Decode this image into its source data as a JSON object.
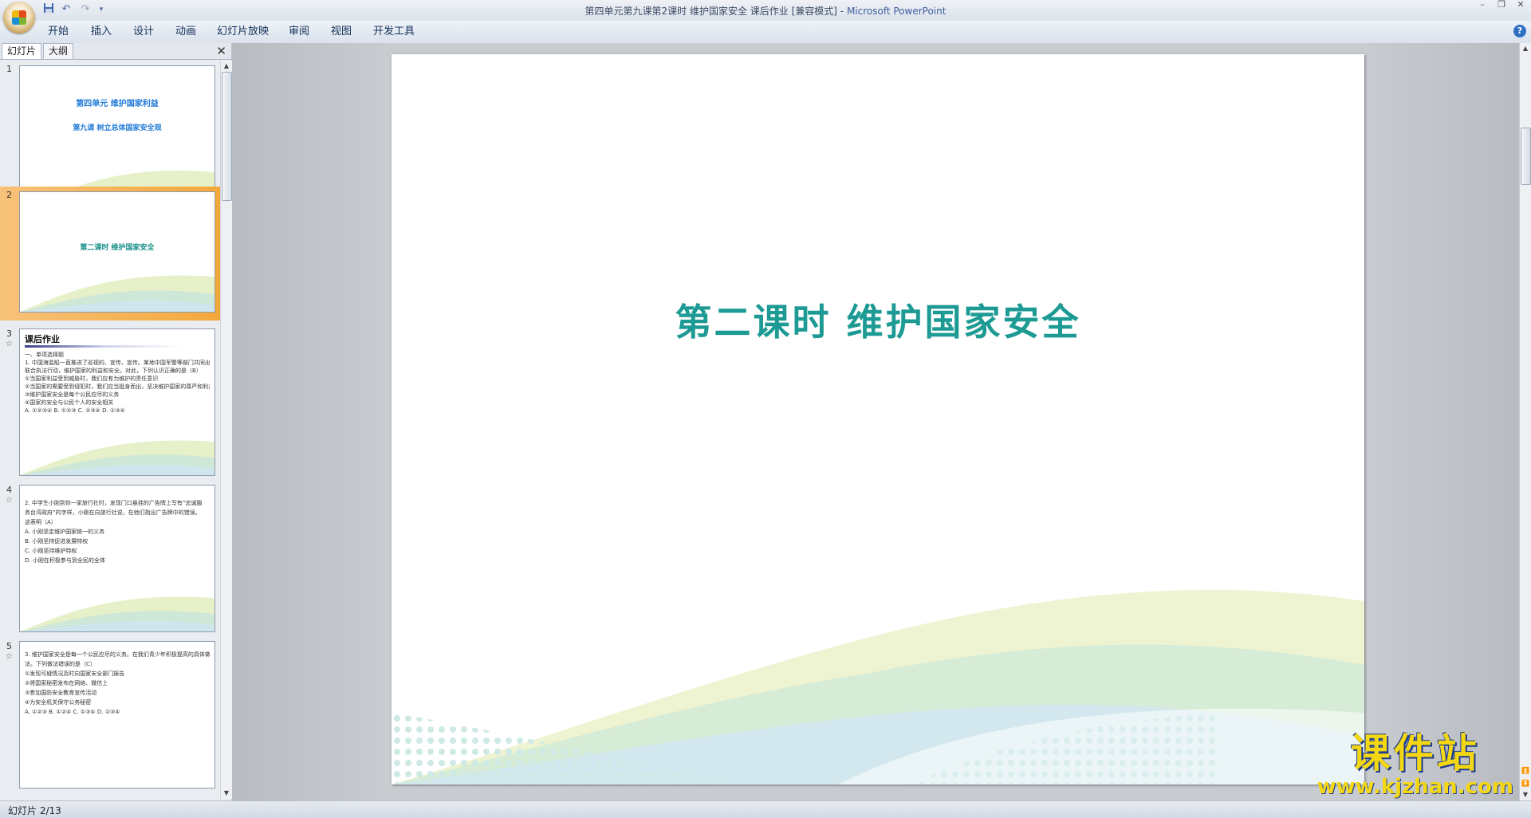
{
  "window": {
    "title": "第四单元第九课第2课时 维护国家安全 课后作业 [兼容模式]",
    "app_name": "Microsoft PowerPoint",
    "title_separator": " - "
  },
  "quick_access": [
    "save-icon",
    "undo-icon",
    "redo-icon",
    "customize-icon"
  ],
  "ribbon_tabs": [
    "开始",
    "插入",
    "设计",
    "动画",
    "幻灯片放映",
    "审阅",
    "视图",
    "开发工具"
  ],
  "left_panel": {
    "tabs": [
      "幻灯片",
      "大纲"
    ],
    "close_label": "✕"
  },
  "thumbnails": [
    {
      "num": "1",
      "title_line1": "第四单元  维护国家利益",
      "title_line2": "第九课   树立总体国家安全观"
    },
    {
      "num": "2",
      "title_line1": "第二课时    维护国家安全"
    },
    {
      "num": "3",
      "heading": "课后作业",
      "lines": [
        "一、单项选择题",
        "1. 中国海监船一直推进了巡视的、宣传、宣传。某地中国军警等部门共同出动开展",
        "联合执法行动，维护国家的利益和安全。对此，下列认识正确的是（B）",
        "①当国家利益受到威胁时，我们应有为维护的责任意识",
        "②当国家的需要受到侵犯时，我们应当挺身而出，坚决维护国家的尊严和利益",
        "③维护国家安全是每个公民应尽的义务",
        "④国家的安全与公民个人的安全相关",
        "A. ①②③④   B. ①②③   C. ②③④   D. ①③④"
      ]
    },
    {
      "num": "4",
      "lines": [
        "2. 中学生小刚到你一家旅行社时，发现门口悬挂的广告牌上写有“忠诚服",
        "务台湾政府”的字样，小刚在向旅行社说，在他们指出广告牌中的错误。",
        "这表明（A）",
        "A. 小刚坚定维护国家统一的义务",
        "B. 小刚坚持促进发展特权",
        "C. 小刚坚持维护特权",
        "D. 小刚在积极参与到全民的全体"
      ]
    },
    {
      "num": "5",
      "lines": [
        "3. 维护国家安全是每一个公民应尽的义务。在我们青少年积极提高的具体做",
        "法。下列做法错误的是（C）",
        "①发现可疑情况及时向国家安全部门报告",
        "②将国家秘密发布在网络、微信上",
        "③参加国防安全教育宣传活动",
        "④为安全机关保守公务秘密",
        "A. ①②③   B. ①②④   C. ①③④   D. ②③④"
      ]
    }
  ],
  "slide": {
    "title": "第二课时    维护国家安全"
  },
  "status": {
    "slide_indicator": "幻灯片 2/13"
  },
  "watermark": {
    "name": "课件站",
    "url": "www.kjzhan.com"
  },
  "colors": {
    "slide_title": "#1d9a94",
    "thumb_title_blue": "#1f7ad6",
    "selected_thumb": "#f4a83a",
    "watermark_yellow": "#f4d713"
  }
}
